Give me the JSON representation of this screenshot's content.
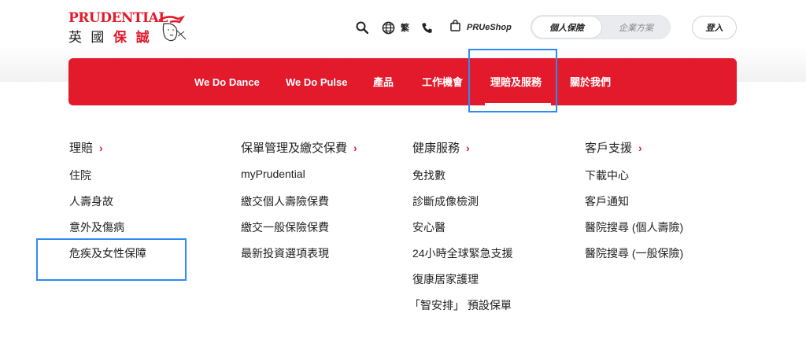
{
  "header": {
    "logo_text_en": "PRUDENTIAL",
    "logo_text_zh_black": "英 國",
    "logo_text_zh_red": "保 誠",
    "icons": {
      "search": "search-icon",
      "language": "globe-icon",
      "phone": "phone-icon",
      "shop": "shopping-bag-icon"
    },
    "language_label": "繁",
    "shop_label": "PRUeShop",
    "segment": {
      "active": "個人保險",
      "inactive": "企業方案"
    },
    "login_label": "登入"
  },
  "nav": {
    "items": [
      "We Do Dance",
      "We Do Pulse",
      "產品",
      "工作機會",
      "理賠及服務",
      "關於我們"
    ],
    "active_index": 4,
    "background": "#e21a2c"
  },
  "menu": {
    "columns": [
      {
        "title": "理賠",
        "links": [
          "住院",
          "人壽身故",
          "意外及傷病",
          "危疾及女性保障"
        ]
      },
      {
        "title": "保單管理及繳交保費",
        "links": [
          "myPrudential",
          "繳交個人壽險保費",
          "繳交一般保險保費",
          "最新投資選項表現"
        ]
      },
      {
        "title": "健康服務",
        "links": [
          "免找數",
          "診斷成像檢測",
          "安心醫",
          "24小時全球緊急支援",
          "復康居家護理",
          "「智安排」 預設保單"
        ]
      },
      {
        "title": "客戶支援",
        "links": [
          "下載中心",
          "客戶通知",
          "醫院搜尋 (個人壽險)",
          "醫院搜尋 (一般保險)"
        ]
      }
    ],
    "chevron": "›"
  },
  "colors": {
    "brand_red": "#e21a2c",
    "highlight_blue": "#2f8bf2"
  }
}
